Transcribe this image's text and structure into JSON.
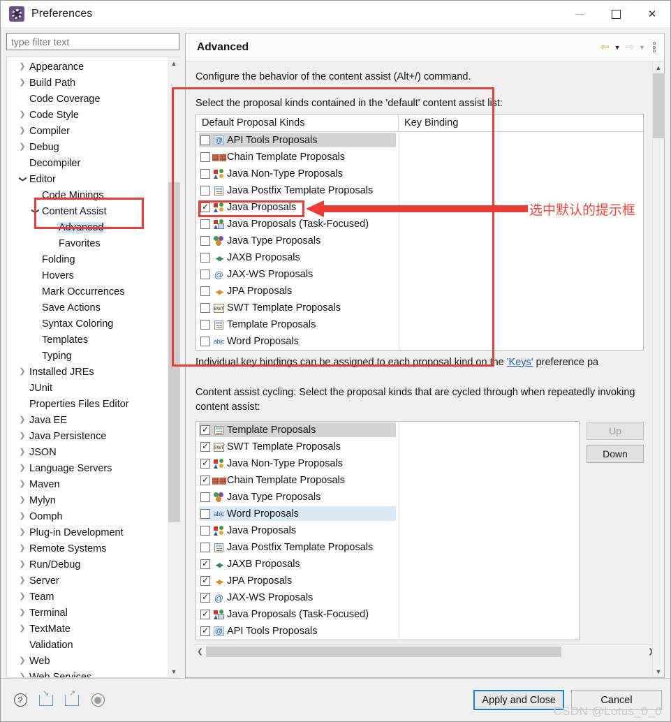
{
  "window": {
    "title": "Preferences",
    "icon": "preferences-gear-icon",
    "controls": {
      "minimize": "—",
      "maximize": "□",
      "close": "✕"
    }
  },
  "sidebar": {
    "filter": {
      "placeholder": "type filter text",
      "value": ""
    },
    "items": [
      {
        "label": "Appearance",
        "depth": 0,
        "arrow": "collapsed"
      },
      {
        "label": "Build Path",
        "depth": 0,
        "arrow": "collapsed"
      },
      {
        "label": "Code Coverage",
        "depth": 0,
        "arrow": "none"
      },
      {
        "label": "Code Style",
        "depth": 0,
        "arrow": "collapsed"
      },
      {
        "label": "Compiler",
        "depth": 0,
        "arrow": "collapsed"
      },
      {
        "label": "Debug",
        "depth": 0,
        "arrow": "collapsed"
      },
      {
        "label": "Decompiler",
        "depth": 0,
        "arrow": "none"
      },
      {
        "label": "Editor",
        "depth": 0,
        "arrow": "expanded"
      },
      {
        "label": "Code Minings",
        "depth": 1,
        "arrow": "none"
      },
      {
        "label": "Content Assist",
        "depth": 1,
        "arrow": "expanded"
      },
      {
        "label": "Advanced",
        "depth": 2,
        "arrow": "none",
        "selected": true
      },
      {
        "label": "Favorites",
        "depth": 2,
        "arrow": "none"
      },
      {
        "label": "Folding",
        "depth": 1,
        "arrow": "none"
      },
      {
        "label": "Hovers",
        "depth": 1,
        "arrow": "none"
      },
      {
        "label": "Mark Occurrences",
        "depth": 1,
        "arrow": "none"
      },
      {
        "label": "Save Actions",
        "depth": 1,
        "arrow": "none"
      },
      {
        "label": "Syntax Coloring",
        "depth": 1,
        "arrow": "none"
      },
      {
        "label": "Templates",
        "depth": 1,
        "arrow": "none"
      },
      {
        "label": "Typing",
        "depth": 1,
        "arrow": "none"
      },
      {
        "label": "Installed JREs",
        "depth": 0,
        "arrow": "collapsed"
      },
      {
        "label": "JUnit",
        "depth": 0,
        "arrow": "none"
      },
      {
        "label": "Properties Files Editor",
        "depth": 0,
        "arrow": "none"
      },
      {
        "label": "Java EE",
        "depth": 0,
        "arrow": "collapsed"
      },
      {
        "label": "Java Persistence",
        "depth": 0,
        "arrow": "collapsed"
      },
      {
        "label": "JSON",
        "depth": 0,
        "arrow": "collapsed"
      },
      {
        "label": "Language Servers",
        "depth": 0,
        "arrow": "collapsed"
      },
      {
        "label": "Maven",
        "depth": 0,
        "arrow": "collapsed"
      },
      {
        "label": "Mylyn",
        "depth": 0,
        "arrow": "collapsed"
      },
      {
        "label": "Oomph",
        "depth": 0,
        "arrow": "collapsed"
      },
      {
        "label": "Plug-in Development",
        "depth": 0,
        "arrow": "collapsed"
      },
      {
        "label": "Remote Systems",
        "depth": 0,
        "arrow": "collapsed"
      },
      {
        "label": "Run/Debug",
        "depth": 0,
        "arrow": "collapsed"
      },
      {
        "label": "Server",
        "depth": 0,
        "arrow": "collapsed"
      },
      {
        "label": "Team",
        "depth": 0,
        "arrow": "collapsed"
      },
      {
        "label": "Terminal",
        "depth": 0,
        "arrow": "collapsed"
      },
      {
        "label": "TextMate",
        "depth": 0,
        "arrow": "collapsed"
      },
      {
        "label": "Validation",
        "depth": 0,
        "arrow": "none"
      },
      {
        "label": "Web",
        "depth": 0,
        "arrow": "collapsed"
      },
      {
        "label": "Web Services",
        "depth": 0,
        "arrow": "collapsed"
      }
    ]
  },
  "page": {
    "title": "Advanced",
    "nav": {
      "back": "⇦",
      "back_caret": "▼",
      "forward": "⇨",
      "forward_caret": "▼",
      "menu": "view-menu-icon"
    },
    "description": "Configure the behavior of the content assist (Alt+/) command.",
    "default_section_label": "Select the proposal kinds contained in the 'default' content assist list:",
    "columns": {
      "kind": "Default Proposal Kinds",
      "key_binding": "Key Binding"
    },
    "default_proposals": [
      {
        "label": "API Tools Proposals",
        "icon": "api-tools-icon",
        "checked": false,
        "row_state": "selected"
      },
      {
        "label": "Chain Template Proposals",
        "icon": "chain-template-icon",
        "checked": false,
        "row_state": "none"
      },
      {
        "label": "Java Non-Type Proposals",
        "icon": "java-icon",
        "checked": false,
        "row_state": "none"
      },
      {
        "label": "Java Postfix Template Proposals",
        "icon": "template-icon",
        "checked": false,
        "row_state": "none"
      },
      {
        "label": "Java Proposals",
        "icon": "java-icon",
        "checked": true,
        "row_state": "none"
      },
      {
        "label": "Java Proposals (Task-Focused)",
        "icon": "java-task-icon",
        "checked": false,
        "row_state": "none"
      },
      {
        "label": "Java Type Proposals",
        "icon": "java-type-icon",
        "checked": false,
        "row_state": "none"
      },
      {
        "label": "JAXB Proposals",
        "icon": "jaxb-icon",
        "checked": false,
        "row_state": "none"
      },
      {
        "label": "JAX-WS Proposals",
        "icon": "jaxws-icon",
        "checked": false,
        "row_state": "none"
      },
      {
        "label": "JPA Proposals",
        "icon": "jpa-icon",
        "checked": false,
        "row_state": "none"
      },
      {
        "label": "SWT Template Proposals",
        "icon": "swt-template-icon",
        "checked": false,
        "row_state": "none"
      },
      {
        "label": "Template Proposals",
        "icon": "template-icon",
        "checked": false,
        "row_state": "none"
      },
      {
        "label": "Word Proposals",
        "icon": "word-icon",
        "checked": false,
        "row_state": "none"
      }
    ],
    "key_binding_note_before": "Individual key bindings can be assigned to each proposal kind on the ",
    "key_binding_link": "'Keys'",
    "key_binding_note_after": " preference pa",
    "cycling_label": "Content assist cycling: Select the proposal kinds that are cycled through when repeatedly invoking content assist:",
    "cycling_proposals": [
      {
        "label": "Template Proposals",
        "icon": "template-icon",
        "checked": true,
        "row_state": "selected"
      },
      {
        "label": "SWT Template Proposals",
        "icon": "swt-template-icon",
        "checked": true,
        "row_state": "none"
      },
      {
        "label": "Java Non-Type Proposals",
        "icon": "java-icon",
        "checked": true,
        "row_state": "none"
      },
      {
        "label": "Chain Template Proposals",
        "icon": "chain-template-icon",
        "checked": true,
        "row_state": "none"
      },
      {
        "label": "Java Type Proposals",
        "icon": "java-type-icon",
        "checked": false,
        "row_state": "none"
      },
      {
        "label": "Word Proposals",
        "icon": "word-icon",
        "checked": false,
        "row_state": "lite"
      },
      {
        "label": "Java Proposals",
        "icon": "java-icon",
        "checked": false,
        "row_state": "none"
      },
      {
        "label": "Java Postfix Template Proposals",
        "icon": "template-icon",
        "checked": false,
        "row_state": "none"
      },
      {
        "label": "JAXB Proposals",
        "icon": "jaxb-icon",
        "checked": true,
        "row_state": "none"
      },
      {
        "label": "JPA Proposals",
        "icon": "jpa-icon",
        "checked": true,
        "row_state": "none"
      },
      {
        "label": "JAX-WS Proposals",
        "icon": "jaxws-icon",
        "checked": true,
        "row_state": "none"
      },
      {
        "label": "Java Proposals (Task-Focused)",
        "icon": "java-task-icon",
        "checked": true,
        "row_state": "none"
      },
      {
        "label": "API Tools Proposals",
        "icon": "api-tools-icon",
        "checked": true,
        "row_state": "none"
      }
    ],
    "up_button": "Up",
    "down_button": "Down"
  },
  "bottom": {
    "icons": [
      "help-icon",
      "import-icon",
      "export-icon",
      "restore-defaults-icon"
    ],
    "apply_and_close": "Apply and Close",
    "cancel": "Cancel",
    "watermark": "CSDN @Lotus_0_0"
  },
  "annotations": {
    "chinese_note": "选中默认的提示框",
    "color": "#ef3b38"
  }
}
